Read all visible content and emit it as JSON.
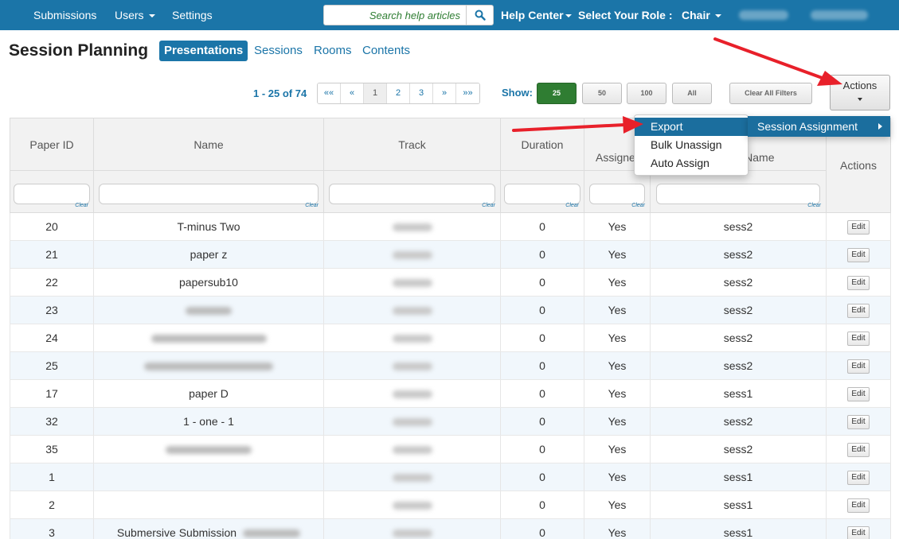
{
  "nav": {
    "items": [
      "Submissions",
      "Users",
      "Settings"
    ],
    "search_placeholder": "Search help articles",
    "help_center": "Help Center",
    "select_role": "Select Your Role :",
    "role": "Chair"
  },
  "header": {
    "title": "Session Planning",
    "tabs": [
      "Presentations",
      "Sessions",
      "Rooms",
      "Contents"
    ],
    "active_tab": "Presentations"
  },
  "pagination": {
    "range": "1 - 25 of 74",
    "controls": [
      "««",
      "«",
      "1",
      "2",
      "3",
      "»",
      "»»"
    ],
    "current_page": "1",
    "show_label": "Show:",
    "sizes": [
      "25",
      "50",
      "100",
      "All"
    ],
    "selected_size": "25",
    "clear_filters": "Clear All Filters"
  },
  "actions_button": "Actions",
  "menu": {
    "items": [
      "Export",
      "Bulk Unassign",
      "Auto Assign"
    ],
    "highlighted": "Export",
    "submenu": "Session Assignment"
  },
  "table": {
    "columns": [
      "Paper ID",
      "Name",
      "Track",
      "Duration",
      "Assigned",
      "Session Name",
      "Actions"
    ],
    "clear_label": "Clear",
    "edit_label": "Edit",
    "rows": [
      {
        "id": "20",
        "name": "T-minus Two",
        "duration": "0",
        "assigned": "Yes",
        "session": "sess2"
      },
      {
        "id": "21",
        "name": "paper z",
        "duration": "0",
        "assigned": "Yes",
        "session": "sess2"
      },
      {
        "id": "22",
        "name": "papersub10",
        "duration": "0",
        "assigned": "Yes",
        "session": "sess2"
      },
      {
        "id": "23",
        "name": "",
        "duration": "0",
        "assigned": "Yes",
        "session": "sess2"
      },
      {
        "id": "24",
        "name": "",
        "duration": "0",
        "assigned": "Yes",
        "session": "sess2"
      },
      {
        "id": "25",
        "name": "",
        "duration": "0",
        "assigned": "Yes",
        "session": "sess2"
      },
      {
        "id": "17",
        "name": "paper D",
        "duration": "0",
        "assigned": "Yes",
        "session": "sess1"
      },
      {
        "id": "32",
        "name": "1 - one - 1",
        "duration": "0",
        "assigned": "Yes",
        "session": "sess2"
      },
      {
        "id": "35",
        "name": "",
        "duration": "0",
        "assigned": "Yes",
        "session": "sess2"
      },
      {
        "id": "1",
        "name": "",
        "duration": "0",
        "assigned": "Yes",
        "session": "sess1"
      },
      {
        "id": "2",
        "name": "",
        "duration": "0",
        "assigned": "Yes",
        "session": "sess1"
      },
      {
        "id": "3",
        "name": "Submersive Submission",
        "duration": "0",
        "assigned": "Yes",
        "session": "sess1"
      }
    ]
  },
  "colors": {
    "nav_bg": "#1b75a8",
    "link": "#1b75a8",
    "show_active": "#2f7d32",
    "menu_highlight": "#1b6e9e",
    "arrow": "#e8202a"
  }
}
